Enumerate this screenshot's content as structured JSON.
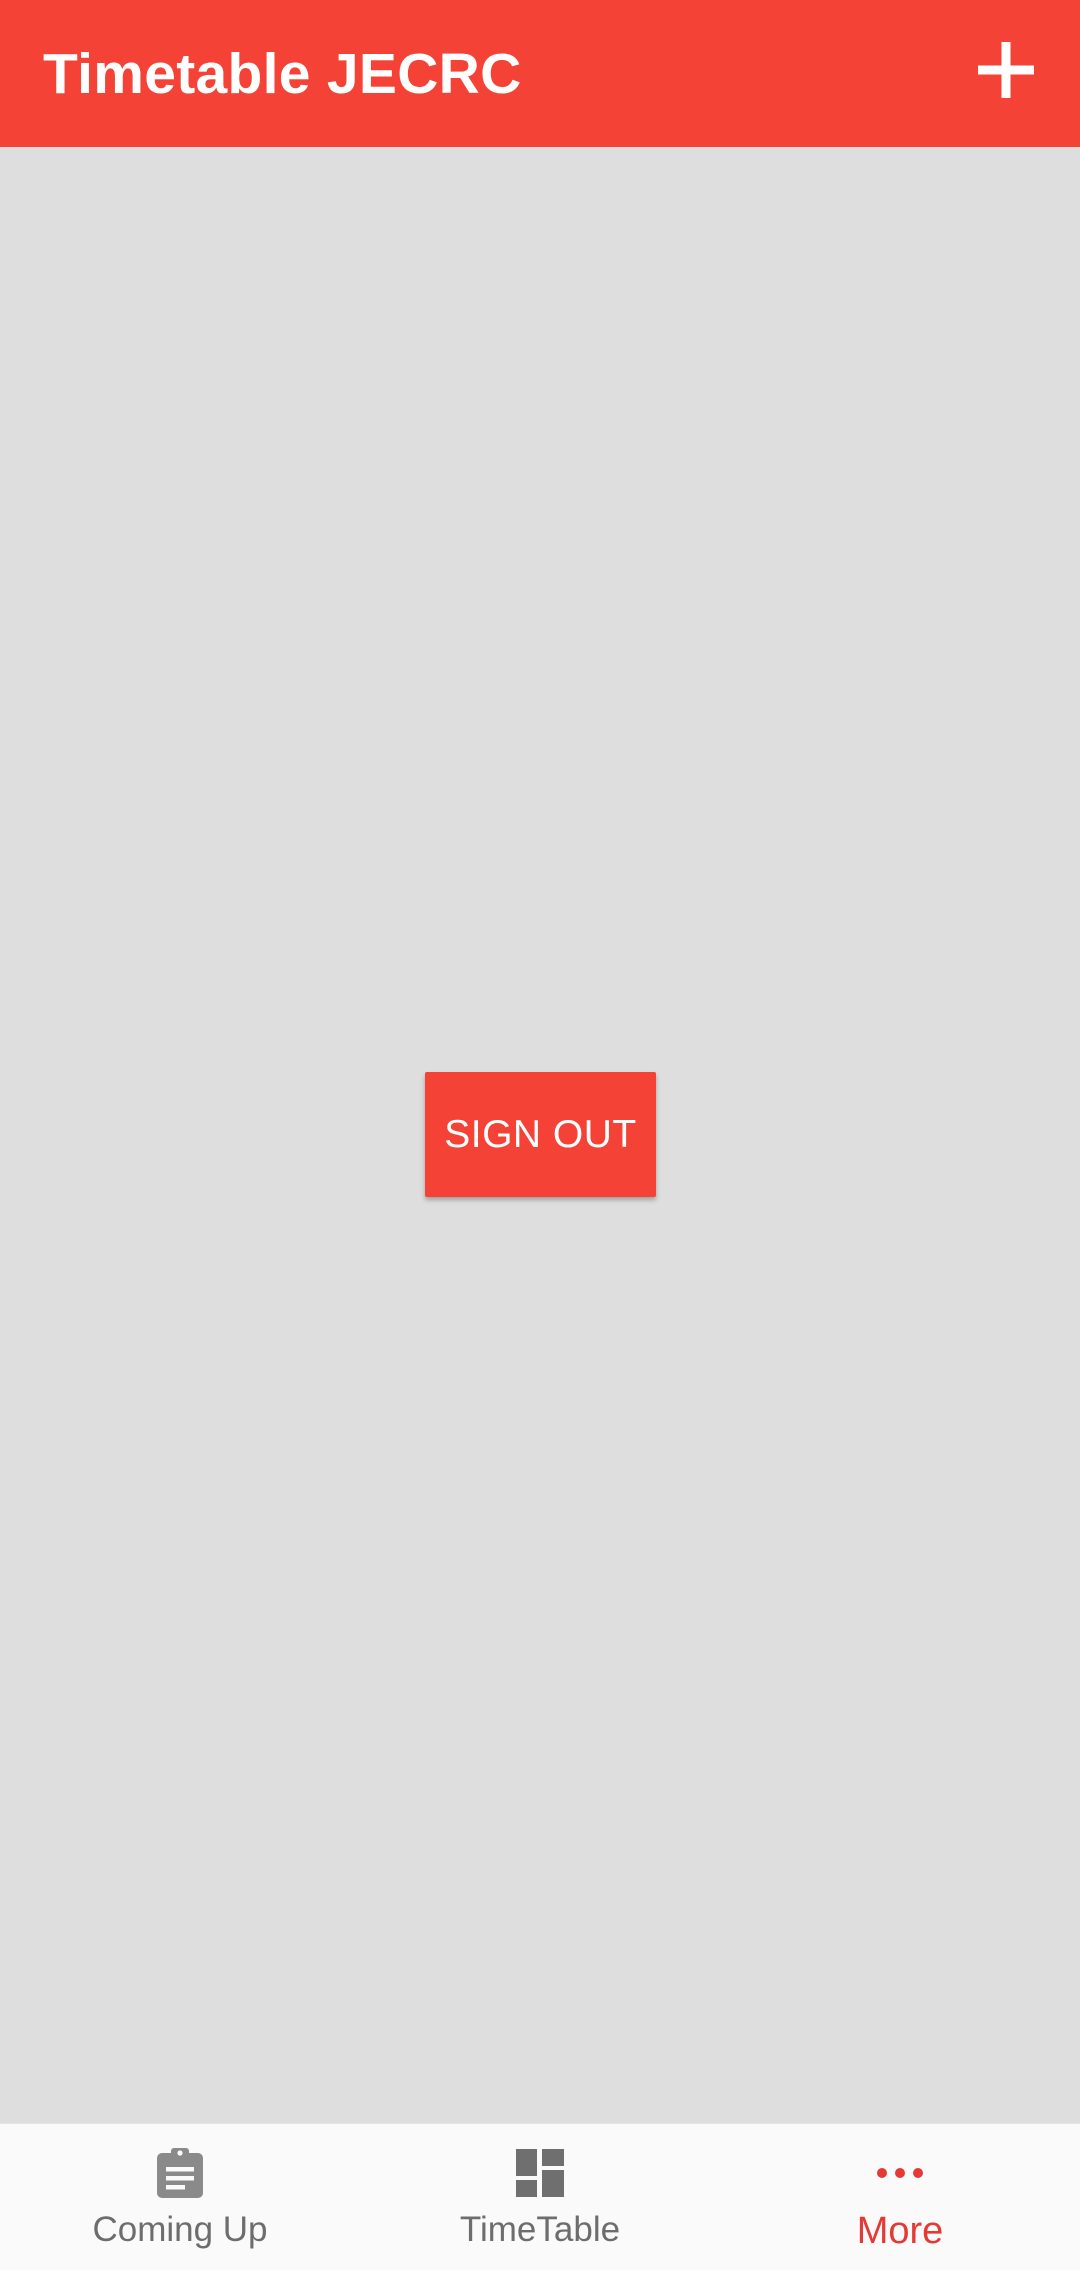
{
  "app_bar": {
    "title": "Timetable JECRC",
    "add_icon": "plus-icon",
    "color": "#f44336"
  },
  "main": {
    "sign_out_label": "SIGN OUT"
  },
  "bottom_nav": {
    "active_index": 2,
    "active_color": "#e53935",
    "inactive_color": "#6d6d6d",
    "items": [
      {
        "label": "Coming Up",
        "icon": "clipboard-icon"
      },
      {
        "label": "TimeTable",
        "icon": "dashboard-icon"
      },
      {
        "label": "More",
        "icon": "more-horizontal-icon"
      }
    ]
  }
}
